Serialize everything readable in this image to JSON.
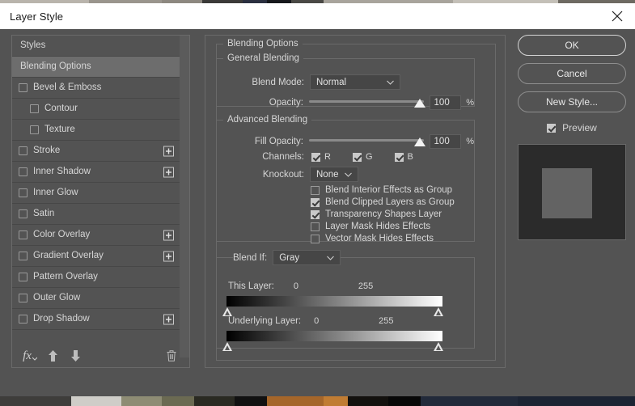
{
  "window": {
    "title": "Layer Style",
    "close_icon": "close-icon"
  },
  "styles_panel": {
    "items": [
      {
        "label": "Styles",
        "type": "header",
        "selected": false,
        "checkbox": false,
        "indent": false,
        "plus": false
      },
      {
        "label": "Blending Options",
        "type": "header",
        "selected": true,
        "checkbox": false,
        "indent": false,
        "plus": false
      },
      {
        "label": "Bevel & Emboss",
        "type": "effect",
        "selected": false,
        "checkbox": true,
        "checked": false,
        "indent": false,
        "plus": false
      },
      {
        "label": "Contour",
        "type": "sub",
        "selected": false,
        "checkbox": true,
        "checked": false,
        "indent": true,
        "plus": false
      },
      {
        "label": "Texture",
        "type": "sub",
        "selected": false,
        "checkbox": true,
        "checked": false,
        "indent": true,
        "plus": false
      },
      {
        "label": "Stroke",
        "type": "effect",
        "selected": false,
        "checkbox": true,
        "checked": false,
        "indent": false,
        "plus": true
      },
      {
        "label": "Inner Shadow",
        "type": "effect",
        "selected": false,
        "checkbox": true,
        "checked": false,
        "indent": false,
        "plus": true
      },
      {
        "label": "Inner Glow",
        "type": "effect",
        "selected": false,
        "checkbox": true,
        "checked": false,
        "indent": false,
        "plus": false
      },
      {
        "label": "Satin",
        "type": "effect",
        "selected": false,
        "checkbox": true,
        "checked": false,
        "indent": false,
        "plus": false
      },
      {
        "label": "Color Overlay",
        "type": "effect",
        "selected": false,
        "checkbox": true,
        "checked": false,
        "indent": false,
        "plus": true
      },
      {
        "label": "Gradient Overlay",
        "type": "effect",
        "selected": false,
        "checkbox": true,
        "checked": false,
        "indent": false,
        "plus": true
      },
      {
        "label": "Pattern Overlay",
        "type": "effect",
        "selected": false,
        "checkbox": true,
        "checked": false,
        "indent": false,
        "plus": false
      },
      {
        "label": "Outer Glow",
        "type": "effect",
        "selected": false,
        "checkbox": true,
        "checked": false,
        "indent": false,
        "plus": false
      },
      {
        "label": "Drop Shadow",
        "type": "effect",
        "selected": false,
        "checkbox": true,
        "checked": false,
        "indent": false,
        "plus": true
      }
    ],
    "toolbar": {
      "fx_label": "fx",
      "fx_icon": "fx-icon",
      "move_up_icon": "arrow-up-icon",
      "move_down_icon": "arrow-down-icon",
      "delete_icon": "trash-icon"
    }
  },
  "options": {
    "section_title": "Blending Options",
    "general": {
      "title": "General Blending",
      "blend_mode_label": "Blend Mode:",
      "blend_mode_value": "Normal",
      "opacity_label": "Opacity:",
      "opacity_value": "100",
      "opacity_unit": "%"
    },
    "advanced": {
      "title": "Advanced Blending",
      "fill_opacity_label": "Fill Opacity:",
      "fill_opacity_value": "100",
      "fill_opacity_unit": "%",
      "channels_label": "Channels:",
      "channels": [
        {
          "label": "R",
          "checked": true
        },
        {
          "label": "G",
          "checked": true
        },
        {
          "label": "B",
          "checked": true
        }
      ],
      "knockout_label": "Knockout:",
      "knockout_value": "None",
      "checkboxes": [
        {
          "label": "Blend Interior Effects as Group",
          "checked": false
        },
        {
          "label": "Blend Clipped Layers as Group",
          "checked": true
        },
        {
          "label": "Transparency Shapes Layer",
          "checked": true
        },
        {
          "label": "Layer Mask Hides Effects",
          "checked": false
        },
        {
          "label": "Vector Mask Hides Effects",
          "checked": false
        }
      ]
    },
    "blend_if": {
      "label": "Blend If:",
      "channel_value": "Gray",
      "this_layer_label": "This Layer:",
      "this_layer_min": "0",
      "this_layer_max": "255",
      "underlying_layer_label": "Underlying Layer:",
      "underlying_layer_min": "0",
      "underlying_layer_max": "255"
    }
  },
  "buttons": {
    "ok": "OK",
    "cancel": "Cancel",
    "new_style": "New Style...",
    "preview_label": "Preview",
    "preview_checked": true
  },
  "colors": {
    "dialog_bg": "#535353",
    "titlebar_bg": "#ffffff",
    "text": "#d6d6d6",
    "selected_row": "#6d6d6d",
    "field_bg": "#464646",
    "border": "#6a6a6a",
    "preview_bg": "#2b2b2b",
    "preview_square": "#636363"
  }
}
